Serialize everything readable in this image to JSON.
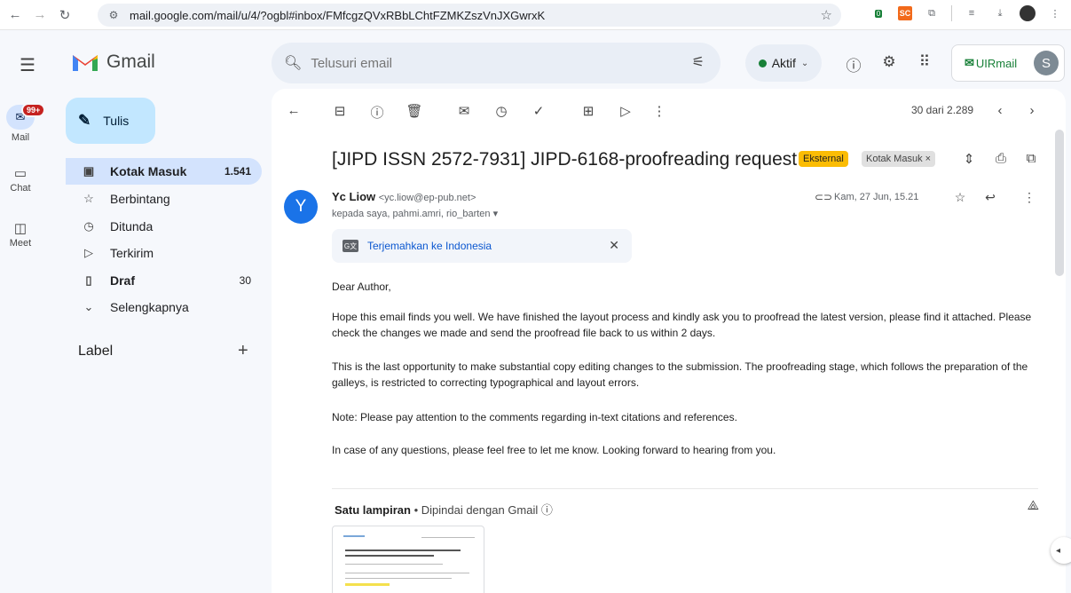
{
  "browser": {
    "url": "mail.google.com/mail/u/4/?ogbl#inbox/FMfcgzQVxRBbLChtFZMKZszVnJXGwrxK",
    "extension_badge": "0",
    "extension_sc": "SC"
  },
  "header": {
    "app_name": "Gmail",
    "search_placeholder": "Telusuri email",
    "status_label": "Aktif",
    "account_brand": "UIRmail",
    "avatar_letter": "S"
  },
  "rail": {
    "mail_label": "Mail",
    "mail_badge": "99+",
    "chat_label": "Chat",
    "meet_label": "Meet"
  },
  "sidebar": {
    "compose_label": "Tulis",
    "items": [
      {
        "label": "Kotak Masuk",
        "count": "1.541",
        "icon": "inbox-icon"
      },
      {
        "label": "Berbintang",
        "count": "",
        "icon": "star-icon"
      },
      {
        "label": "Ditunda",
        "count": "",
        "icon": "clock-icon"
      },
      {
        "label": "Terkirim",
        "count": "",
        "icon": "send-icon"
      },
      {
        "label": "Draf",
        "count": "30",
        "icon": "draft-icon"
      },
      {
        "label": "Selengkapnya",
        "count": "",
        "icon": "chevron-down-icon"
      }
    ],
    "label_heading": "Label"
  },
  "toolbar": {
    "count_text": "30 dari 2.289"
  },
  "email": {
    "subject": "[JIPD ISSN 2572-7931] JIPD-6168-proofreading request",
    "chip_external": "Eksternal",
    "chip_inbox": "Kotak Masuk ×",
    "sender_initial": "Y",
    "sender_name": "Yc Liow",
    "sender_email": "<yc.liow@ep-pub.net>",
    "recipients": "kepada saya, pahmi.amri, rio_barten ▾",
    "date": "Kam, 27 Jun, 15.21",
    "translate_link": "Terjemahkan ke Indonesia",
    "body": [
      "Dear Author,",
      "Hope this email finds you well. We have finished the layout process and kindly ask you to proofread the latest version, please find it attached. Please check the changes we made and send the proofread file back to us within 2 days.",
      "This is the last opportunity to make substantial copy editing changes to the submission.  The proofreading stage, which follows the preparation of the galleys, is restricted to correcting typographical and layout errors.",
      "Note: Please pay attention to the comments regarding in-text citations and references.",
      "In case of any questions, please feel free to let me know. Looking forward to hearing from you."
    ],
    "attachment_heading": "Satu lampiran",
    "attachment_scanned": " • Dipindai dengan Gmail ⓘ"
  }
}
